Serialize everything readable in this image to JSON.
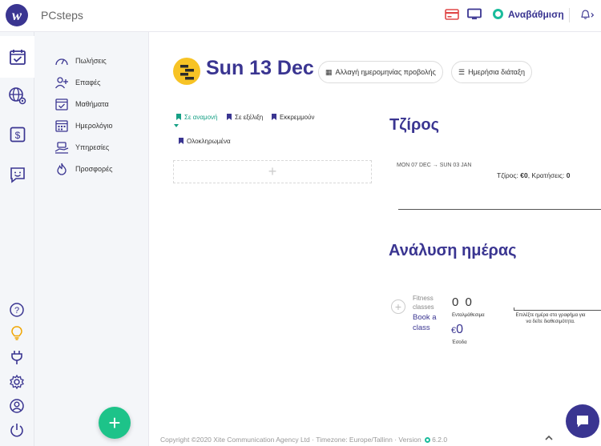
{
  "app": {
    "brand": "PCsteps",
    "logo_letter": "w"
  },
  "topbar": {
    "upgrade_label": "Αναβάθμιση"
  },
  "sidebar": {
    "items": [
      {
        "label": "Πωλήσεις",
        "icon": "speedometer-icon"
      },
      {
        "label": "Επαφές",
        "icon": "user-add-icon"
      },
      {
        "label": "Μαθήματα",
        "icon": "calendar-check-icon"
      },
      {
        "label": "Ημερολόγιο",
        "icon": "calendar-grid-icon"
      },
      {
        "label": "Υπηρεσίες",
        "icon": "hand-service-icon"
      },
      {
        "label": "Προσφορές",
        "icon": "flame-icon"
      }
    ]
  },
  "fab": {
    "label": "+"
  },
  "main": {
    "date_title": "Sun 13 Dec",
    "change_date_button": "Αλλαγή ημερομηνίας προβολής",
    "daily_layout_button": "Ημερήσια διάταξη",
    "tabs": [
      {
        "label": "Σε αναμονή"
      },
      {
        "label": "Σε εξέλιξη"
      },
      {
        "label": "Εκκρεμμούν"
      },
      {
        "label": "Ολοκληρωμένα"
      }
    ],
    "add_placeholder": "+",
    "turnover": {
      "heading": "Τζίρος",
      "range_start": "MON 07 DEC",
      "range_arrow": "→",
      "range_end": "SUN 03 JAN",
      "turnover_label": "Τζίρος:",
      "turnover_value": "€0",
      "bookings_label": ", Κρατήσεις:",
      "bookings_value": "0"
    },
    "analysis": {
      "heading": "Ανάλυση ημέρας",
      "fitness_label": "Fitness classes",
      "book_label": "Book a class",
      "count_a": "0",
      "count_b": "0",
      "completed_label": "Ενταλμάθεσιμα",
      "revenue_currency": "€",
      "revenue_value": "0",
      "revenue_label": "Έσοδα",
      "hint": "Επιλέξτε ημέρα στο γραφήμα για να δείτε διαθεσιμότητα."
    }
  },
  "footer": {
    "copyright": "Copyright ©2020 Xite Communication Agency Ltd",
    "separator": "·",
    "timezone": "Timezone: Europe/Tallinn",
    "version_label": "Version",
    "version_value": "6.2.0"
  },
  "colors": {
    "brand": "#3a3591",
    "accent": "#1abc9c",
    "fab": "#1dc389",
    "day_icon": "#f7c325"
  }
}
